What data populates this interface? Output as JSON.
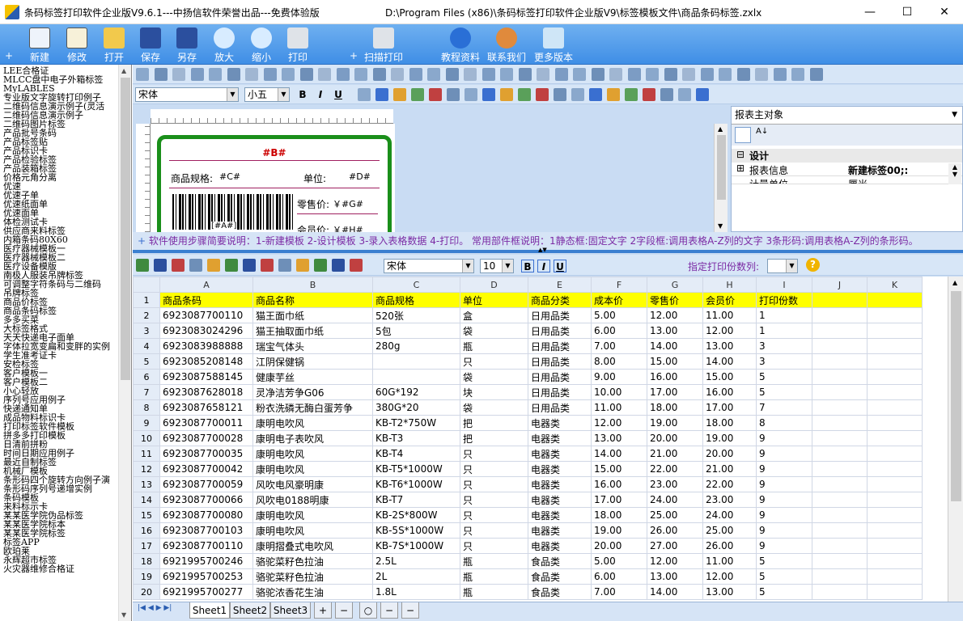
{
  "titlebar": {
    "app_title": "条码标签打印软件企业版V9.6.1---中扬信软件荣誉出品---免费体验版",
    "file_path": "D:\\Program Files (x86)\\条码标签打印软件企业版V9\\标签模板文件\\商品条码标签.zxlx",
    "minimize": "—",
    "maximize": "☐",
    "close": "✕"
  },
  "toolbar": {
    "new": "新建",
    "edit": "修改",
    "open": "打开",
    "save": "保存",
    "save_as": "另存",
    "zoom_in": "放大",
    "zoom_out": "缩小",
    "print": "打印",
    "scan_print": "扫描打印",
    "tutorial": "教程资料",
    "contact": "联系我们",
    "more": "更多版本",
    "plus": "+"
  },
  "sidebar": {
    "items": [
      "LEE合格证",
      "MLCC盘中电子外箱标签",
      "MyLABLES",
      "专业版文字旋转打印例子",
      "二维码信息演示例子(灵活",
      "二维码信息演示例子",
      "二维码图片标签",
      "产品批号条码",
      "产品标签贴",
      "产品标识卡",
      "产品检验标签",
      "产品装箱标签",
      "价格元角分离",
      "优速",
      "优速子单",
      "优速纸面单",
      "优速面单",
      "体检测试卡",
      "供应商来料标签",
      "内箱条码80X60",
      "医疗器械模板一",
      "医疗器械模板二",
      "医疗设备模版",
      "南极人服装吊牌标签",
      "可调整字符条码与二维码",
      "吊牌标签",
      "商品价标签",
      "商品条码标签",
      "多多买菜",
      "大标签格式",
      "天天快递电子面单",
      "字体拉宽变扁和变胖的实例",
      "学生准考证卡",
      "安检标签",
      "客户模板一",
      "客户模板二",
      "小心轻放",
      "序列号应用例子",
      "快递通知单",
      "成品物料标识卡",
      "打印标签软件模板",
      "拼多多打印模板",
      "日清前拼粉",
      "时间日期应用例子",
      "最近自制标签",
      "机械厂模板",
      "条形码四个旋转方向例子演",
      "条形码序列号递增实例",
      "条码模板",
      "来料标示卡",
      "某某医学院伪品标签",
      "某某医学院标本",
      "某某医学院标签",
      "标签APP",
      "欧珀莱",
      "永辉超市标签",
      "火灾器维修合格证"
    ]
  },
  "format": {
    "font_name": "宋体",
    "font_size": "小五",
    "bold": "B",
    "italic": "I",
    "underline": "U"
  },
  "label": {
    "title_field": "#B#",
    "spec_label": "商品规格:",
    "spec_field": "#C#",
    "unit_label": "单位:",
    "unit_field": "#D#",
    "price_label": "零售价:",
    "price_field": "￥#G#",
    "member_label": "会员价:",
    "member_field": "￥#H#",
    "barcode_field": "[#A#]"
  },
  "props": {
    "selector": "报表主对象",
    "category": "设计",
    "rows": [
      {
        "key": "报表信息",
        "value": "新建标签00;:"
      },
      {
        "key": "计量单位",
        "value": "厘米"
      }
    ]
  },
  "help_text": "软件使用步骤简要说明：1-新建模板 2-设计模板 3-录入表格数据 4-打印。  常用部件框说明：1静态框:固定文字 2字段框:调用表格A-Z列的文字 3条形码:调用表格A-Z列的条形码。",
  "sheet_toolbar": {
    "font_name": "宋体",
    "font_size": "10",
    "print_col_label": "指定打印份数列:",
    "bold": "B",
    "italic": "I",
    "underline": "U"
  },
  "grid": {
    "columns": [
      "A",
      "B",
      "C",
      "D",
      "E",
      "F",
      "G",
      "H",
      "I",
      "J",
      "K"
    ],
    "rows": [
      [
        "商品条码",
        "商品名称",
        "商品规格",
        "单位",
        "商品分类",
        "成本价",
        "零售价",
        "会员价",
        "打印份数",
        "",
        ""
      ],
      [
        "6923087700110",
        "猫王面巾纸",
        "520张",
        "盒",
        "日用品类",
        "5.00",
        "12.00",
        "11.00",
        "1",
        "",
        ""
      ],
      [
        "6923083024296",
        "猫王抽取面巾纸",
        "5包",
        "袋",
        "日用品类",
        "6.00",
        "13.00",
        "12.00",
        "1",
        "",
        ""
      ],
      [
        "6923083988888",
        "瑞宝气体头",
        "280g",
        "瓶",
        "日用品类",
        "7.00",
        "14.00",
        "13.00",
        "3",
        "",
        ""
      ],
      [
        "6923085208148",
        "江阴保健锅",
        "",
        "只",
        "日用品类",
        "8.00",
        "15.00",
        "14.00",
        "3",
        "",
        ""
      ],
      [
        "6923087588145",
        "健康芋丝",
        "",
        "袋",
        "日用品类",
        "9.00",
        "16.00",
        "15.00",
        "5",
        "",
        ""
      ],
      [
        "6923087628018",
        "灵净洁芳争G06",
        "60G*192",
        "块",
        "日用品类",
        "10.00",
        "17.00",
        "16.00",
        "5",
        "",
        ""
      ],
      [
        "6923087658121",
        "粉衣洗磷无酶白蛋芳争",
        "380G*20",
        "袋",
        "日用品类",
        "11.00",
        "18.00",
        "17.00",
        "7",
        "",
        ""
      ],
      [
        "6923087700011",
        "康明电吹风",
        "KB-T2*750W",
        "把",
        "电器类",
        "12.00",
        "19.00",
        "18.00",
        "8",
        "",
        ""
      ],
      [
        "6923087700028",
        "康明电子表吹风",
        "KB-T3",
        "把",
        "电器类",
        "13.00",
        "20.00",
        "19.00",
        "9",
        "",
        ""
      ],
      [
        "6923087700035",
        "康明电吹风",
        "KB-T4",
        "只",
        "电器类",
        "14.00",
        "21.00",
        "20.00",
        "9",
        "",
        ""
      ],
      [
        "6923087700042",
        "康明电吹风",
        "KB-T5*1000W",
        "只",
        "电器类",
        "15.00",
        "22.00",
        "21.00",
        "9",
        "",
        ""
      ],
      [
        "6923087700059",
        "风吹电风豪明康",
        "KB-T6*1000W",
        "只",
        "电器类",
        "16.00",
        "23.00",
        "22.00",
        "9",
        "",
        ""
      ],
      [
        "6923087700066",
        "风吹电0188明康",
        "KB-T7",
        "只",
        "电器类",
        "17.00",
        "24.00",
        "23.00",
        "9",
        "",
        ""
      ],
      [
        "6923087700080",
        "康明电吹风",
        "KB-2S*800W",
        "只",
        "电器类",
        "18.00",
        "25.00",
        "24.00",
        "9",
        "",
        ""
      ],
      [
        "6923087700103",
        "康明电吹风",
        "KB-5S*1000W",
        "只",
        "电器类",
        "19.00",
        "26.00",
        "25.00",
        "9",
        "",
        ""
      ],
      [
        "6923087700110",
        "康明摺叠式电吹风",
        "KB-7S*1000W",
        "只",
        "电器类",
        "20.00",
        "27.00",
        "26.00",
        "9",
        "",
        ""
      ],
      [
        "6921995700246",
        "骆驼菜籽色拉油",
        "2.5L",
        "瓶",
        "食品类",
        "5.00",
        "12.00",
        "11.00",
        "5",
        "",
        ""
      ],
      [
        "6921995700253",
        "骆驼菜籽色拉油",
        "2L",
        "瓶",
        "食品类",
        "6.00",
        "13.00",
        "12.00",
        "5",
        "",
        ""
      ],
      [
        "6921995700277",
        "骆驼浓香花生油",
        "1.8L",
        "瓶",
        "食品类",
        "7.00",
        "14.00",
        "13.00",
        "5",
        "",
        ""
      ]
    ]
  },
  "sheets": {
    "tabs": [
      "Sheet1",
      "Sheet2",
      "Sheet3"
    ],
    "plus": "+",
    "minus": "−",
    "circle": "○"
  }
}
